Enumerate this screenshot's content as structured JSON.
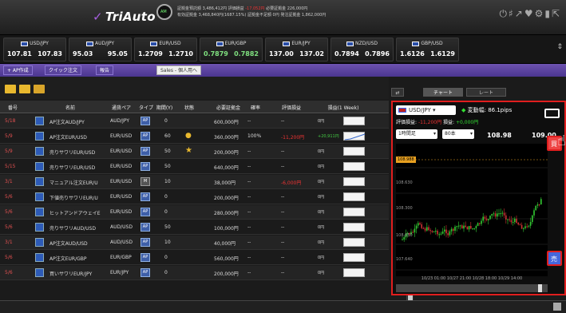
{
  "app": {
    "logo": "TriAuto",
    "clock_label": "AM"
  },
  "account": {
    "line1": "証拠金預託額 3,486,412円    評価損益 ",
    "line1_red": "-17,052円",
    "line1b": "    必要証拠金 226,000円",
    "line2": "有効証拠金 3,468,840円(1687.15%) 証拠金不足額 0円    発注証拠金 1,862,000円"
  },
  "top_icons": "⏻♯↗♥⚙▮⇱",
  "pairs": [
    {
      "name": "USD/JPY",
      "bid": "107.81",
      "ask": "107.83"
    },
    {
      "name": "AUD/JPY",
      "bid": "95.03",
      "ask": "95.05"
    },
    {
      "name": "EUR/USD",
      "bid": "1.2709",
      "ask": "1.2710"
    },
    {
      "name": "EUR/GBP",
      "bid": "0.7879",
      "ask": "0.7882"
    },
    {
      "name": "EUR/JPY",
      "bid": "137.00",
      "ask": "137.02"
    },
    {
      "name": "NZD/USD",
      "bid": "0.7894",
      "ask": "0.7896"
    },
    {
      "name": "GBP/USD",
      "bid": "1.6126",
      "ask": "1.6129"
    }
  ],
  "toolbar": {
    "add": "+ AP作成",
    "quick": "クイック注文",
    "report": "報告",
    "filter": "Sales - 個人用へ"
  },
  "right_tabs": [
    "チャート",
    "レート"
  ],
  "table": {
    "headers": [
      "番号",
      "名前",
      "通貨ペア",
      "タイプ",
      "期間(Y)",
      "状態",
      "必要証拠金",
      "確率",
      "評価損益",
      "損益(1 Week)"
    ],
    "rows": [
      {
        "date": "5/18",
        "name": "AP注文AUD/JPY",
        "pair": "AUD/JPY",
        "type": "AP",
        "qty": "0",
        "margin": "600,000円",
        "rate": "--",
        "pl": "--",
        "week": "0円"
      },
      {
        "date": "5/9",
        "name": "AP注文EUR/USD",
        "pair": "EUR/USD",
        "type": "AP",
        "qty": "60",
        "margin": "360,000円",
        "rate": "100%",
        "pl": "-11,200円",
        "week": "+20,911円"
      },
      {
        "date": "5/9",
        "name": "売りサワリEUR/USD",
        "pair": "EUR/USD",
        "type": "AP",
        "qty": "50",
        "margin": "200,000円",
        "rate": "--",
        "pl": "--",
        "week": "0円"
      },
      {
        "date": "5/15",
        "name": "売りサワリEUR/USD",
        "pair": "EUR/USD",
        "type": "AP",
        "qty": "50",
        "margin": "640,000円",
        "rate": "--",
        "pl": "--",
        "week": "0円"
      },
      {
        "date": "3/1",
        "name": "マニュアル注文EUR/U",
        "pair": "EUR/USD",
        "type": "M",
        "qty": "10",
        "margin": "38,000円",
        "rate": "--",
        "pl": "-6,000円",
        "week": "0円"
      },
      {
        "date": "5/6",
        "name": "下値売りサワリEUR/U",
        "pair": "EUR/USD",
        "type": "AP",
        "qty": "0",
        "margin": "200,000円",
        "rate": "--",
        "pl": "--",
        "week": "0円"
      },
      {
        "date": "5/6",
        "name": "ヒットアンドアウェイE",
        "pair": "EUR/USD",
        "type": "AP",
        "qty": "0",
        "margin": "280,000円",
        "rate": "--",
        "pl": "--",
        "week": "0円"
      },
      {
        "date": "5/6",
        "name": "売りサワリAUD/USD",
        "pair": "AUD/USD",
        "type": "AP",
        "qty": "50",
        "margin": "100,000円",
        "rate": "--",
        "pl": "--",
        "week": "0円"
      },
      {
        "date": "3/1",
        "name": "AP注文AUD/USD",
        "pair": "AUD/USD",
        "type": "AP",
        "qty": "10",
        "margin": "40,000円",
        "rate": "--",
        "pl": "--",
        "week": "0円"
      },
      {
        "date": "5/6",
        "name": "AP注文EUR/GBP",
        "pair": "EUR/GBP",
        "type": "AP",
        "qty": "0",
        "margin": "560,000円",
        "rate": "--",
        "pl": "--",
        "week": "0円"
      },
      {
        "date": "5/6",
        "name": "買いサワリEUR/JPY",
        "pair": "EUR/JPY",
        "type": "AP",
        "qty": "0",
        "margin": "200,000円",
        "rate": "--",
        "pl": "--",
        "week": "0円"
      }
    ]
  },
  "panel": {
    "pair": "USD/JPY",
    "volatility": "変動幅: 86.1pips",
    "pl_label": "評価損益:",
    "pl_value": "-11,200円",
    "gain_label": "損益:",
    "gain_value": "+0,000円",
    "timeframe": "1時間足",
    "count": "80本",
    "bid": "108.98",
    "ask": "109.00",
    "high_label": "108.988",
    "price_ticks": [
      "108.630",
      "108.300",
      "108.050",
      "107.640"
    ],
    "x_axis": "10/23 01:00  10/27 21:00  10/28 18:00  10/29 14:00",
    "buy_label": "買",
    "sell_label": "売"
  },
  "colors": {
    "accent": "#6d53b0",
    "highlight": "#e01e1e",
    "positive": "#3d3"
  }
}
